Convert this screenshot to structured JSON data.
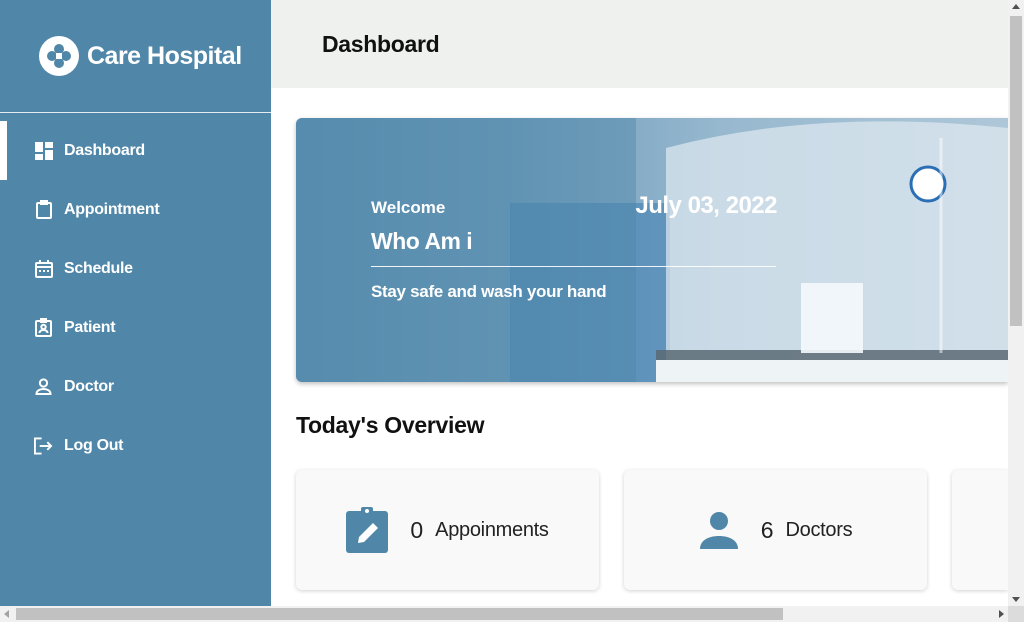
{
  "brand": {
    "name": "Care Hospital",
    "icon": "hospital-logo-icon",
    "primary_color": "#5087a8"
  },
  "nav": {
    "items": [
      {
        "label": "Dashboard",
        "icon": "dashboard-icon",
        "active": true
      },
      {
        "label": "Appointment",
        "icon": "clipboard-icon"
      },
      {
        "label": "Schedule",
        "icon": "calendar-icon"
      },
      {
        "label": "Patient",
        "icon": "patient-badge-icon"
      },
      {
        "label": "Doctor",
        "icon": "person-icon"
      },
      {
        "label": "Log Out",
        "icon": "logout-icon"
      }
    ]
  },
  "header": {
    "title": "Dashboard"
  },
  "hero": {
    "welcome": "Welcome",
    "date": "July 03, 2022",
    "name": "Who Am i",
    "tagline": "Stay safe and wash your hand"
  },
  "overview": {
    "title": "Today's Overview",
    "cards": [
      {
        "count": "0",
        "label": "Appoinments",
        "icon": "clipboard-edit-icon"
      },
      {
        "count": "6",
        "label": "Doctors",
        "icon": "person-icon"
      }
    ]
  }
}
